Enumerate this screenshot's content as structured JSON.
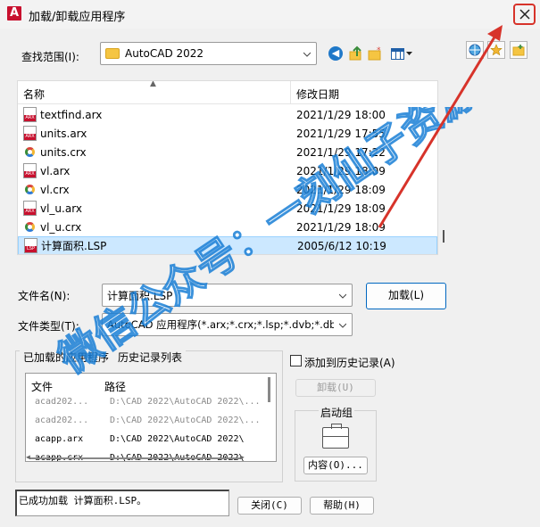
{
  "titlebar": {
    "title": "加载/卸载应用程序",
    "logo": "A"
  },
  "lookin": {
    "label": "查找范围(I):",
    "value": "AutoCAD 2022"
  },
  "filelist": {
    "col_name": "名称",
    "col_date": "修改日期",
    "rows": [
      {
        "icon": "arx",
        "name": "textfind.arx",
        "date": "2021/1/29 18:00"
      },
      {
        "icon": "arx",
        "name": "units.arx",
        "date": "2021/1/29 17:55"
      },
      {
        "icon": "crx",
        "name": "units.crx",
        "date": "2021/1/29 17:22"
      },
      {
        "icon": "arx",
        "name": "vl.arx",
        "date": "2021/1/29 18:09"
      },
      {
        "icon": "crx",
        "name": "vl.crx",
        "date": "2021/1/29 18:09"
      },
      {
        "icon": "arx",
        "name": "vl_u.arx",
        "date": "2021/1/29 18:09"
      },
      {
        "icon": "crx",
        "name": "vl_u.crx",
        "date": "2021/1/29 18:09"
      },
      {
        "icon": "lsp",
        "name": "计算面积.LSP",
        "date": "2005/6/12 10:19",
        "selected": true
      }
    ]
  },
  "filename": {
    "label": "文件名(N):",
    "value": "计算面积.LSP"
  },
  "filetype": {
    "label": "文件类型(T):",
    "value": "AutoCAD 应用程序(*.arx;*.crx;*.lsp;*.dvb;*.dbx"
  },
  "load_button": "加载(L)",
  "tabs": {
    "loaded": "已加载的应用程序",
    "history": "历史记录列表"
  },
  "loaded_list": {
    "col_file": "文件",
    "col_path": "路径",
    "rows": [
      {
        "file": "acad202...",
        "path": "D:\\CAD 2022\\AutoCAD 2022\\...",
        "dim": true
      },
      {
        "file": "acad202...",
        "path": "D:\\CAD 2022\\AutoCAD 2022\\...",
        "dim": true
      },
      {
        "file": "acapp.arx",
        "path": "D:\\CAD 2022\\AutoCAD 2022\\",
        "dim": false
      },
      {
        "file": "acapp.crx",
        "path": "D:\\CAD 2022\\AutoCAD 2022\\",
        "dim": false
      }
    ]
  },
  "add_history": "添加到历史记录(A)",
  "unload_button": "卸载(U)",
  "startup": {
    "label": "启动组",
    "contents_button": "内容(O)..."
  },
  "status_text": "已成功加载 计算面积.LSP。",
  "close_button": "关闭(C)",
  "help_button": "帮助(H)",
  "watermark": "微信公众号：一刻仙子资源库",
  "colors": {
    "accent": "#0067c0",
    "selected_row": "#cce8ff",
    "annotation": "#d7332a",
    "watermark": "#1a7fd6"
  }
}
